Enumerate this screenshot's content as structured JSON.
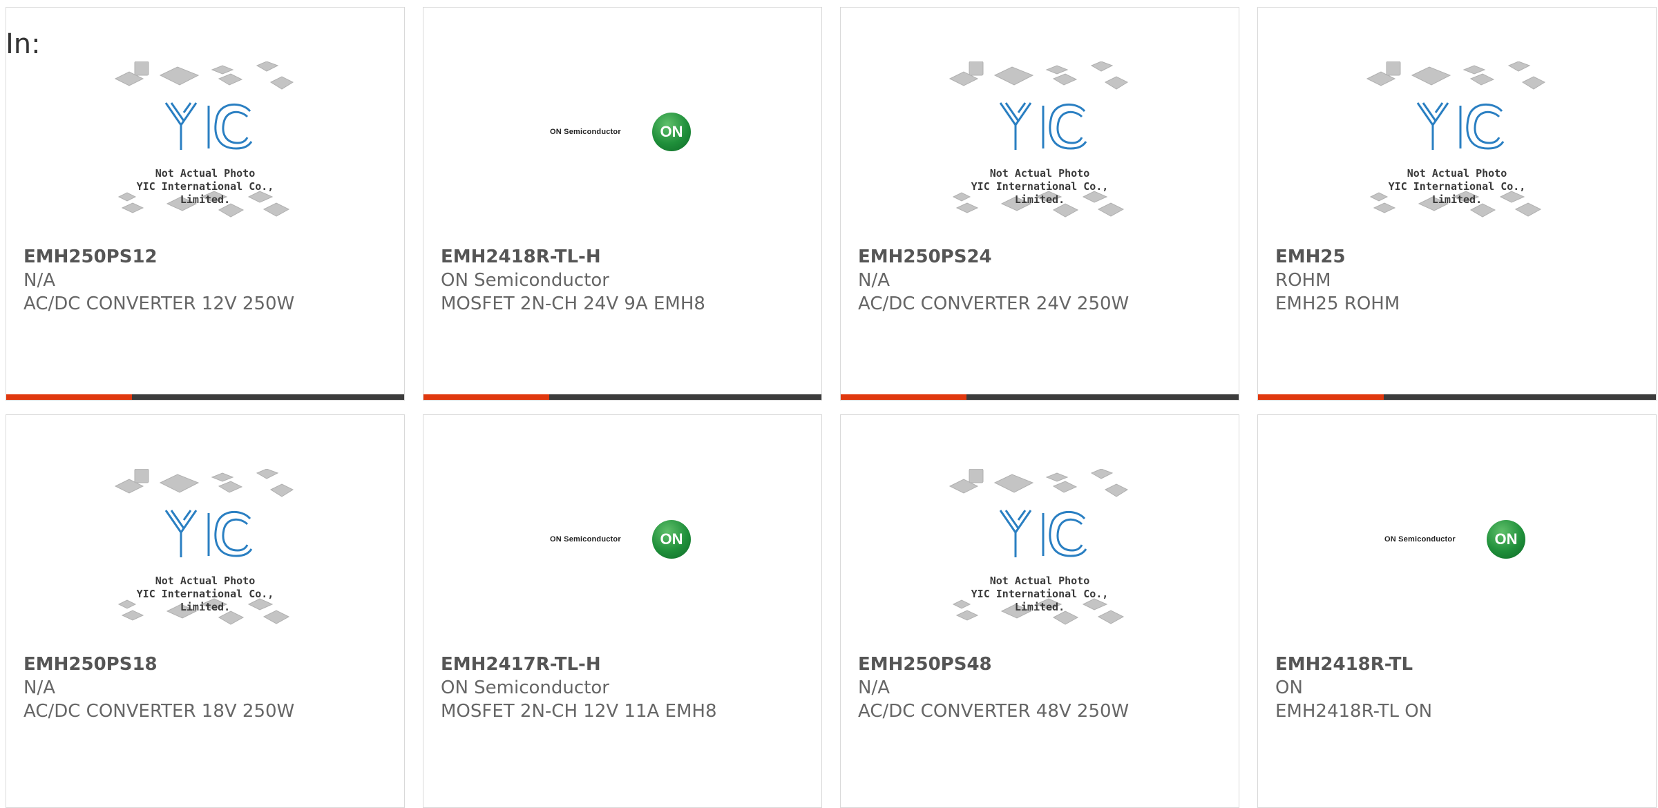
{
  "header": {
    "label": "In:"
  },
  "placeholder": {
    "caption_line1": "Not Actual Photo",
    "caption_line2": "YIC International Co., Limited."
  },
  "on_logo": {
    "brand": "ON Semiconductor",
    "mark": "ON"
  },
  "colors": {
    "accent": "#e0380e",
    "bar": "#3c3c3c",
    "on_green": "#1f8f3a",
    "yic_blue": "#2a7fc2"
  },
  "products": [
    {
      "part": "EMH250PS12",
      "maker": "N/A",
      "desc": "AC/DC CONVERTER 12V 250W",
      "image": "yic-placeholder"
    },
    {
      "part": "EMH2418R-TL-H",
      "maker": "ON Semiconductor",
      "desc": "MOSFET 2N-CH 24V 9A EMH8",
      "image": "on-semiconductor-logo"
    },
    {
      "part": "EMH250PS24",
      "maker": "N/A",
      "desc": "AC/DC CONVERTER 24V 250W",
      "image": "yic-placeholder"
    },
    {
      "part": "EMH25",
      "maker": "ROHM",
      "desc": "EMH25 ROHM",
      "image": "yic-placeholder"
    },
    {
      "part": "EMH250PS18",
      "maker": "N/A",
      "desc": "AC/DC CONVERTER 18V 250W",
      "image": "yic-placeholder"
    },
    {
      "part": "EMH2417R-TL-H",
      "maker": "ON Semiconductor",
      "desc": "MOSFET 2N-CH 12V 11A EMH8",
      "image": "on-semiconductor-logo"
    },
    {
      "part": "EMH250PS48",
      "maker": "N/A",
      "desc": "AC/DC CONVERTER 48V 250W",
      "image": "yic-placeholder"
    },
    {
      "part": "EMH2418R-TL",
      "maker": "ON",
      "desc": "EMH2418R-TL ON",
      "image": "on-semiconductor-logo"
    }
  ]
}
